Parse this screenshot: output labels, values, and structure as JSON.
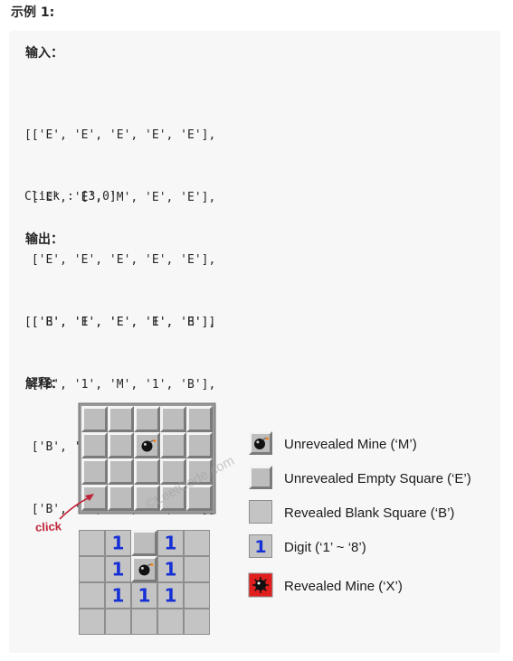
{
  "heading": "示例 1:",
  "input_label": "输入：",
  "input_lines": [
    "[['E', 'E', 'E', 'E', 'E'],",
    " ['E', 'E', 'M', 'E', 'E'],",
    " ['E', 'E', 'E', 'E', 'E'],",
    " ['E', 'E', 'E', 'E', 'E']]"
  ],
  "click_line": "Click : [3,0]",
  "output_label": "输出：",
  "output_lines": [
    "[['B', '1', 'E', '1', 'B'],",
    " ['B', '1', 'M', '1', 'B'],",
    " ['B', '1', '1', '1', 'B'],",
    " ['B', 'B', 'B', 'B', 'B']]"
  ],
  "explain_label": "解释：",
  "figure": {
    "click_label": "click",
    "watermark": "©LeetCode.com",
    "top_board": [
      [
        "E",
        "E",
        "E",
        "E",
        "E"
      ],
      [
        "E",
        "E",
        "M",
        "E",
        "E"
      ],
      [
        "E",
        "E",
        "E",
        "E",
        "E"
      ],
      [
        "E",
        "E",
        "E",
        "E",
        "E"
      ]
    ],
    "bottom_board": [
      [
        "B",
        "1",
        "E",
        "1",
        "B"
      ],
      [
        "B",
        "1",
        "M",
        "1",
        "B"
      ],
      [
        "B",
        "1",
        "1",
        "1",
        "B"
      ],
      [
        "B",
        "B",
        "B",
        "B",
        "B"
      ]
    ],
    "digit_color": "#1530d6",
    "mine_color": "#111111",
    "revealed_mine_bg": "#e01e1e"
  },
  "legend": [
    {
      "icon": "mine-icon",
      "text": "Unrevealed Mine (‘M’)"
    },
    {
      "icon": "empty-square-icon",
      "text": "Unrevealed Empty Square (‘E’)"
    },
    {
      "icon": "blank-square-icon",
      "text": "Revealed Blank Square (‘B’)"
    },
    {
      "icon": "digit-icon",
      "text": "Digit (‘1’ ~ ‘8’)"
    },
    {
      "icon": "revealed-mine-icon",
      "text": "Revealed Mine (‘X’)"
    }
  ]
}
